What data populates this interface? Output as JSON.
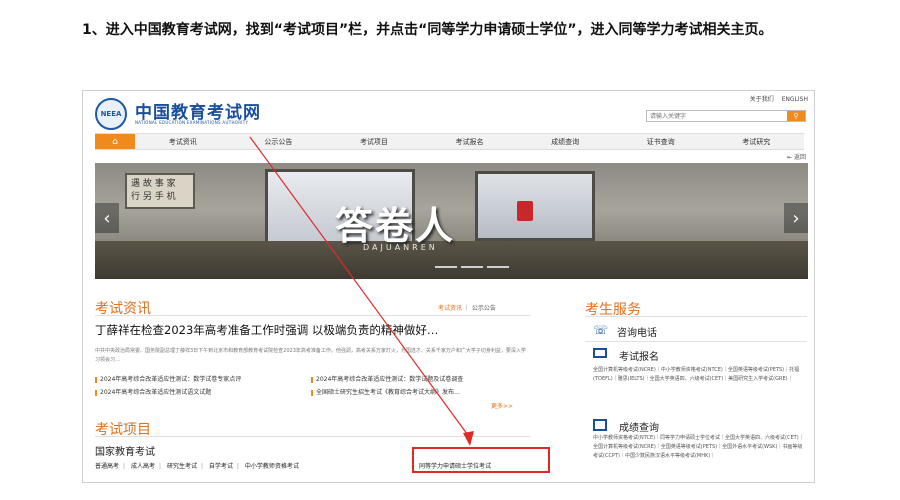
{
  "instruction": "1、进入中国教育考试网，找到“考试项目”栏，并点击“同等学力申请硕士学位”，进入同等学力考试相关主页。",
  "site": {
    "logo_seal": "NEEA",
    "logo_cn": "中国教育考试网",
    "logo_en": "NATIONAL EDUCATION EXAMINATIONS AUTHORITY",
    "top_links": [
      "关于我们",
      "ENGLISH"
    ],
    "search_placeholder": "请输入关键字",
    "search_icon": "magnifier"
  },
  "nav": {
    "home_icon": "home",
    "items": [
      "考试资讯",
      "公示公告",
      "考试项目",
      "考试报名",
      "成绩查询",
      "证书查询",
      "考试研究"
    ]
  },
  "back_link": "⇤ 返回",
  "banner": {
    "board_text": "遇 故 事 家\n行 另 手 机",
    "title": "答卷人",
    "subtitle": "DAJUANREN"
  },
  "news": {
    "title": "考试资讯",
    "tabs": [
      "考试资讯",
      "公示公告"
    ],
    "headline": "丁薛祥在检查2023年高考准备工作时强调 以极端负责的精神做好…",
    "summary": "中共中央政治局常委、国务院副总理丁薛祥3日下午到北京市和教育部教育考试院检查2023年高考准备工作。他强调，高考关系万家灯火，为国选才、关系千家万户和广大学子切身利益，要深入学习领会习…",
    "items": [
      "2024年高考综合改革适应性测试：数学试卷专家点评",
      "2024年高考综合改革适应性测试：数学试题及试卷调查",
      "2024年高考综合改革适应性测试语文试题",
      "全国硕士研究生招生考试《教育综合考试大纲》发布…"
    ],
    "more": "更多>>"
  },
  "projects": {
    "title": "考试项目",
    "subtitle": "国家教育考试",
    "links": [
      "普通高考",
      "成人高考",
      "研究生考试",
      "自学考试",
      "中小学教师资格考试"
    ],
    "highlight": "同等学力申请硕士学位考试"
  },
  "service": {
    "title": "考生服务",
    "phone": "咨询电话",
    "register": "考试报名",
    "register_list": "全国计算机等级考试(NCRE)｜中小学教师资格考试(NTCE)｜全国英语等级考试(PETS)｜托福(TOEFL)｜雅思(IELTS)｜全国大学英语四、六级考试(CET)｜美国研究生入学考试(GRE)｜",
    "score": "成绩查询",
    "score_list": "中小学教师资格考试(NTCE)｜同等学力申请硕士学位考试｜全国大学英语四、六级考试(CET)｜全国计算机等级考试(NCRE)｜全国英语等级考试(PETS)｜全国外语水平考试(WSK)｜书画等级考试(CCPT)｜中国少数民族汉语水平等级考试(MHK)｜"
  },
  "colors": {
    "accent": "#f08a1c",
    "brand_blue": "#1a4f9c",
    "highlight_red": "#e02a2a"
  }
}
